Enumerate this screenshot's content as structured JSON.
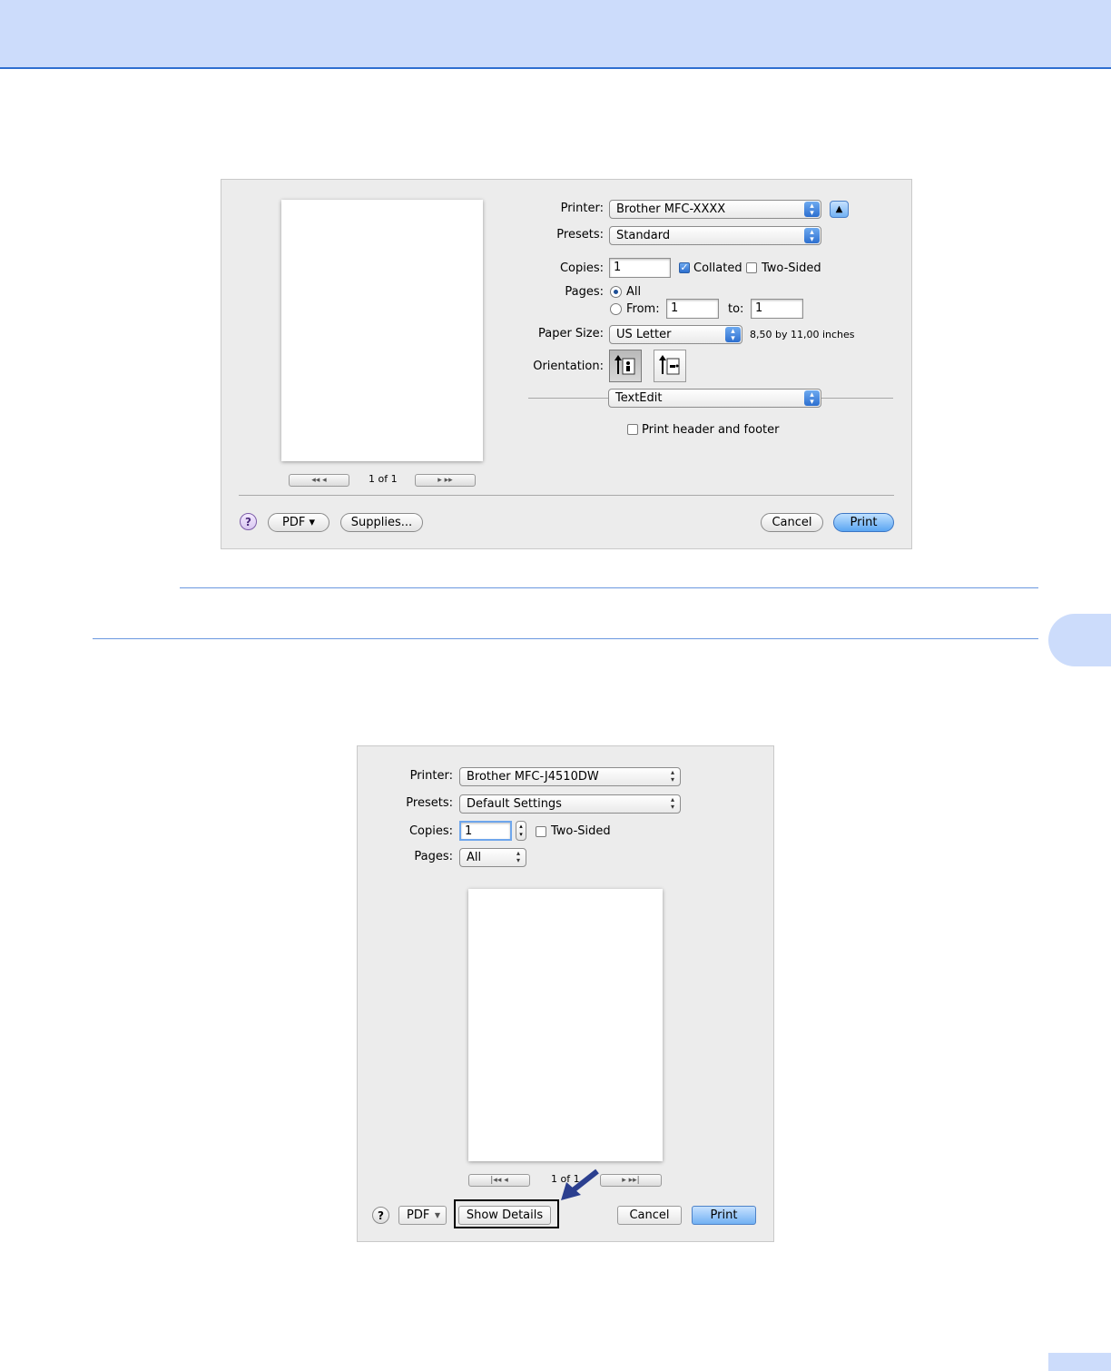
{
  "dialog1": {
    "printer_label": "Printer:",
    "printer_value": "Brother MFC-XXXX",
    "presets_label": "Presets:",
    "presets_value": "Standard",
    "copies_label": "Copies:",
    "copies_value": "1",
    "collated_label": "Collated",
    "collated_checked": true,
    "two_sided_label": "Two-Sided",
    "two_sided_checked": false,
    "pages_label": "Pages:",
    "pages_all_label": "All",
    "pages_from_label": "From:",
    "pages_from_value": "1",
    "pages_to_label": "to:",
    "pages_to_value": "1",
    "paper_size_label": "Paper Size:",
    "paper_size_value": "US Letter",
    "paper_size_desc": "8,50 by 11,00 inches",
    "orientation_label": "Orientation:",
    "section_value": "TextEdit",
    "header_footer_label": "Print header and footer",
    "header_footer_checked": false,
    "page_counter": "1 of 1",
    "help_glyph": "?",
    "pdf_label": "PDF ▾",
    "supplies_label": "Supplies...",
    "cancel_label": "Cancel",
    "print_label": "Print"
  },
  "dialog2": {
    "printer_label": "Printer:",
    "printer_value": "Brother MFC-J4510DW",
    "presets_label": "Presets:",
    "presets_value": "Default Settings",
    "copies_label": "Copies:",
    "copies_value": "1",
    "two_sided_label": "Two-Sided",
    "two_sided_checked": false,
    "pages_label": "Pages:",
    "pages_value": "All",
    "page_counter": "1 of 1",
    "help_glyph": "?",
    "pdf_label": "PDF",
    "show_details_label": "Show Details",
    "cancel_label": "Cancel",
    "print_label": "Print"
  },
  "colors": {
    "header_band": "#ccdcfb",
    "rule": "#6a98e0",
    "accent_blue": "#2d6fcf",
    "callout_arrow": "#2b3f8f"
  }
}
